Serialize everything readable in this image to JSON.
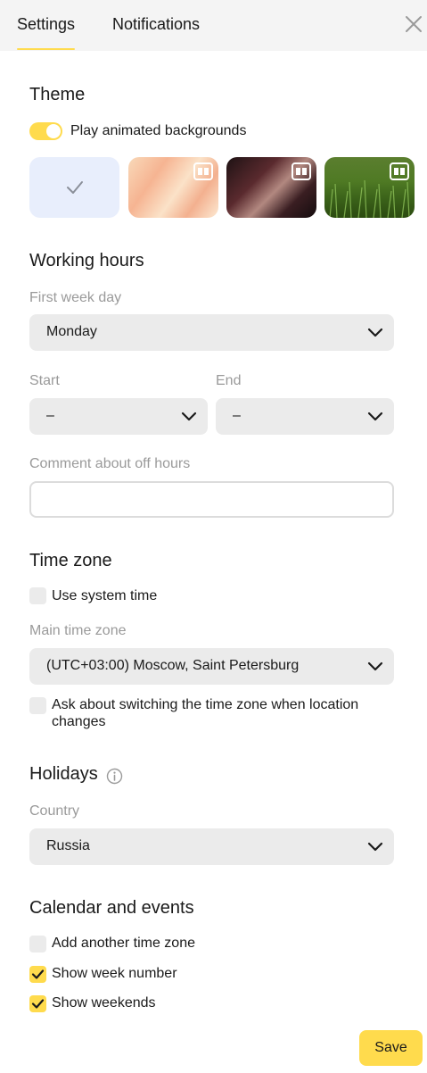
{
  "tabs": {
    "settings": "Settings",
    "notifications": "Notifications"
  },
  "theme": {
    "title": "Theme",
    "animated_label": "Play animated backgrounds",
    "animated_on": true,
    "thumbnails": [
      "plain-selected",
      "peach-silk",
      "dark-silk",
      "green-grass"
    ]
  },
  "working_hours": {
    "title": "Working hours",
    "first_week_day_label": "First week day",
    "first_week_day_value": "Monday",
    "start_label": "Start",
    "start_value": "–",
    "end_label": "End",
    "end_value": "–",
    "comment_label": "Comment about off hours",
    "comment_value": ""
  },
  "time_zone": {
    "title": "Time zone",
    "use_system_label": "Use system time",
    "use_system_checked": false,
    "main_tz_label": "Main time zone",
    "main_tz_value": "(UTC+03:00) Moscow, Saint Petersburg",
    "ask_switch_label_line1": "Ask about switching the time zone when location",
    "ask_switch_label_line2": "changes",
    "ask_switch_checked": false
  },
  "holidays": {
    "title": "Holidays",
    "country_label": "Country",
    "country_value": "Russia"
  },
  "calendar": {
    "title": "Calendar and events",
    "add_tz_label": "Add another time zone",
    "add_tz_checked": false,
    "week_number_label": "Show week number",
    "week_number_checked": true,
    "weekends_label": "Show weekends",
    "weekends_checked": true
  },
  "actions": {
    "save": "Save"
  },
  "colors": {
    "accent": "#ffdb4d",
    "field_bg": "#ebebeb",
    "muted_text": "#9a9a9a"
  }
}
